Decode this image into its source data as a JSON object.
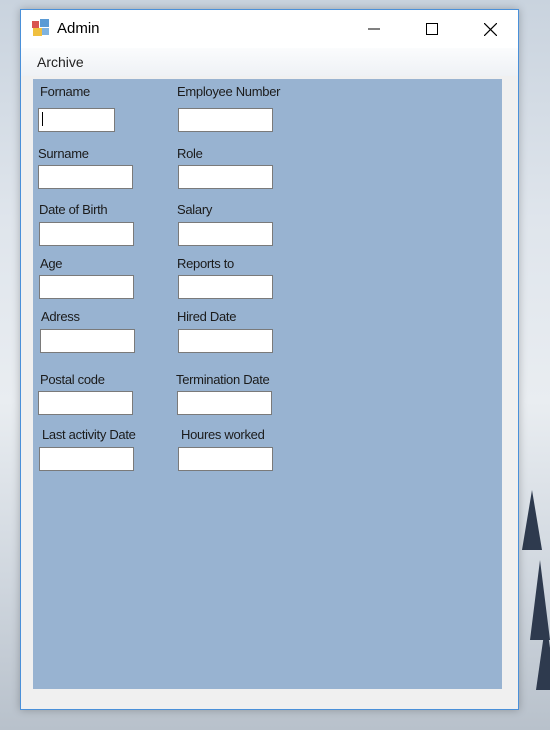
{
  "window": {
    "title": "Admin"
  },
  "menubar": {
    "items": [
      "Archive"
    ]
  },
  "form": {
    "forname": {
      "label": "Forname",
      "value": ""
    },
    "surname": {
      "label": "Surname",
      "value": ""
    },
    "date_of_birth": {
      "label": "Date of Birth",
      "value": ""
    },
    "age": {
      "label": "Age",
      "value": ""
    },
    "adress": {
      "label": "Adress",
      "value": ""
    },
    "postal_code": {
      "label": "Postal code",
      "value": ""
    },
    "last_activity_date": {
      "label": "Last activity Date",
      "value": ""
    },
    "employee_number": {
      "label": "Employee Number",
      "value": ""
    },
    "role": {
      "label": "Role",
      "value": ""
    },
    "salary": {
      "label": "Salary",
      "value": ""
    },
    "reports_to": {
      "label": "Reports to",
      "value": ""
    },
    "hired_date": {
      "label": "Hired Date",
      "value": ""
    },
    "termination_date": {
      "label": "Termination Date",
      "value": ""
    },
    "houres_worked": {
      "label": "Houres worked",
      "value": ""
    }
  },
  "colors": {
    "form_background": "#98b3d1",
    "window_border": "#4a90d9"
  },
  "icons": {
    "app": "app-form-icon",
    "minimize": "minimize-icon",
    "maximize": "maximize-icon",
    "close": "close-icon"
  }
}
